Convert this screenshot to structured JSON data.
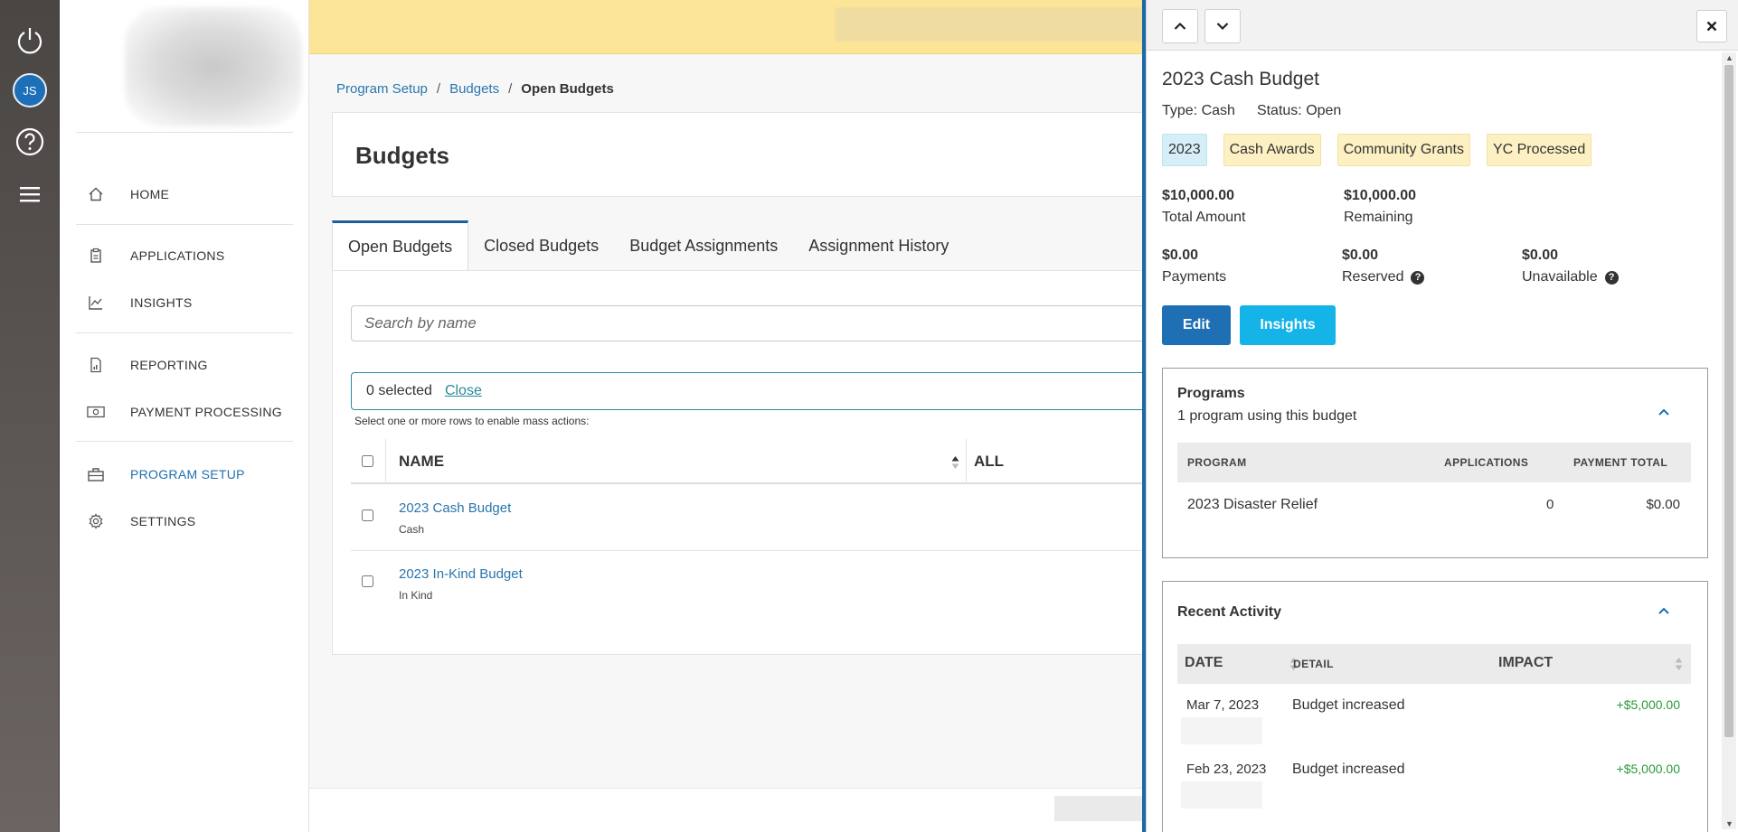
{
  "rail": {
    "avatar_initials": "JS"
  },
  "nav": {
    "items": [
      {
        "label": "HOME",
        "icon": "home-icon"
      },
      {
        "label": "APPLICATIONS",
        "icon": "clipboard-icon"
      },
      {
        "label": "INSIGHTS",
        "icon": "chart-icon"
      },
      {
        "label": "REPORTING",
        "icon": "report-icon"
      },
      {
        "label": "PAYMENT PROCESSING",
        "icon": "money-icon"
      },
      {
        "label": "PROGRAM SETUP",
        "icon": "toolbox-icon",
        "active": true
      },
      {
        "label": "SETTINGS",
        "icon": "gear-icon"
      }
    ]
  },
  "breadcrumb": {
    "item1": "Program Setup",
    "item2": "Budgets",
    "current": "Open Budgets"
  },
  "page": {
    "title": "Budgets"
  },
  "tabs": [
    "Open Budgets",
    "Closed Budgets",
    "Budget Assignments",
    "Assignment History"
  ],
  "search": {
    "placeholder": "Search by name"
  },
  "selection": {
    "count_text": "0 selected",
    "close_label": "Close",
    "hint": "Select one or more rows to enable mass actions:"
  },
  "table": {
    "col_name": "NAME",
    "col_partial": "ALL",
    "rows": [
      {
        "name": "2023 Cash Budget",
        "type": "Cash"
      },
      {
        "name": "2023 In-Kind Budget",
        "type": "In Kind"
      }
    ]
  },
  "panel": {
    "title": "2023 Cash Budget",
    "type_text": "Type: Cash",
    "status_text": "Status: Open",
    "tags": [
      "2023",
      "Cash Awards",
      "Community Grants",
      "YC Processed"
    ],
    "total_amount": {
      "value": "$10,000.00",
      "label": "Total Amount"
    },
    "remaining": {
      "value": "$10,000.00",
      "label": "Remaining"
    },
    "payments": {
      "value": "$0.00",
      "label": "Payments"
    },
    "reserved": {
      "value": "$0.00",
      "label": "Reserved"
    },
    "unavailable": {
      "value": "$0.00",
      "label": "Unavailable"
    },
    "edit_label": "Edit",
    "insights_label": "Insights",
    "programs": {
      "title": "Programs",
      "subtitle": "1 program using this budget",
      "headers": [
        "PROGRAM",
        "APPLICATIONS",
        "PAYMENT TOTAL"
      ],
      "rows": [
        {
          "program": "2023 Disaster Relief",
          "applications": "0",
          "payment_total": "$0.00"
        }
      ]
    },
    "activity": {
      "title": "Recent Activity",
      "headers": [
        "DATE",
        "DETAIL",
        "IMPACT"
      ],
      "rows": [
        {
          "date": "Mar 7, 2023",
          "detail": "Budget increased",
          "impact": "+$5,000.00"
        },
        {
          "date": "Feb 23, 2023",
          "detail": "Budget increased",
          "impact": "+$5,000.00"
        }
      ]
    }
  },
  "colors": {
    "primary": "#1f6fb5",
    "accent": "#14b3e8",
    "banner": "#fde597",
    "positive": "#2a9a3a",
    "tag": "#fdf1c4",
    "tag_year": "#d6eef7"
  }
}
